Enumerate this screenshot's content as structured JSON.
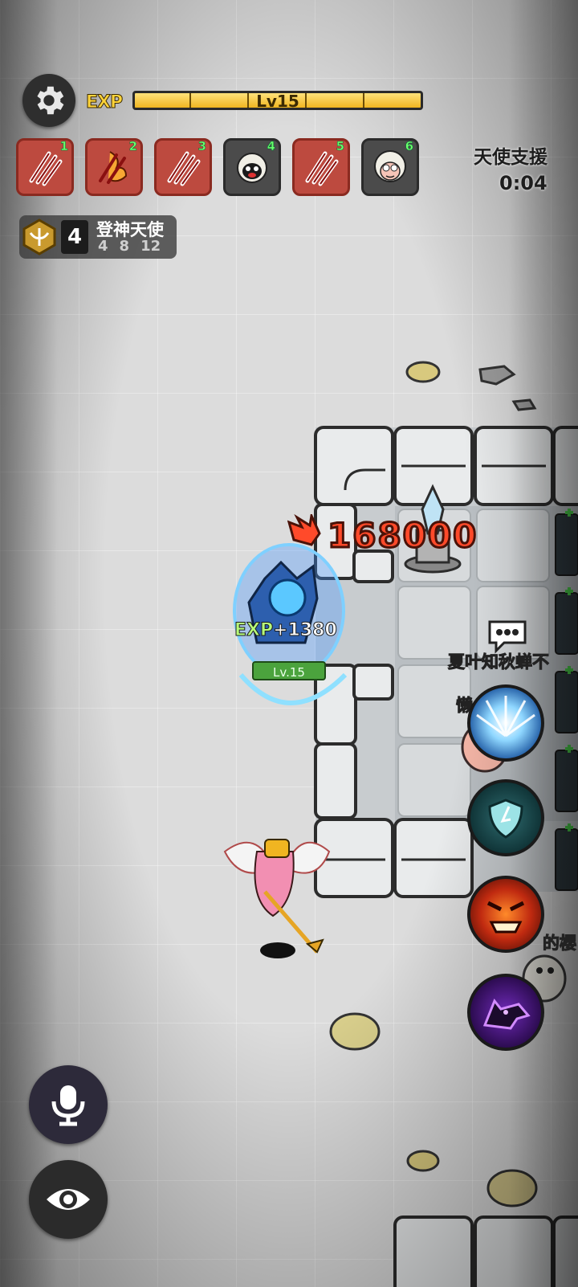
{
  "hud": {
    "exp_label": "EXP",
    "level_text": "Lv15",
    "exp_progress": 1.0
  },
  "skill_slots": [
    {
      "num": "1",
      "style": "red",
      "icon": "claw-icon"
    },
    {
      "num": "2",
      "style": "red",
      "icon": "flame-claw-icon"
    },
    {
      "num": "3",
      "style": "red",
      "icon": "claw-icon"
    },
    {
      "num": "4",
      "style": "dark",
      "icon": "black-sheep-icon"
    },
    {
      "num": "5",
      "style": "red",
      "icon": "claw-icon"
    },
    {
      "num": "6",
      "style": "dark",
      "icon": "white-sheep-icon"
    }
  ],
  "support": {
    "label": "天使支援",
    "timer": "0:04"
  },
  "title_badge": {
    "count": "4",
    "name": "登神天使",
    "tiers": [
      "4",
      "8",
      "12"
    ]
  },
  "combat": {
    "damage": "168000",
    "exp_tag": "EXP",
    "exp_gain": "+1380",
    "enemy_level": "Lv.15"
  },
  "other_players": {
    "name_1": "夏叶知秋蝉不",
    "name_2": "懒",
    "name_3": "的樱"
  },
  "colors": {
    "exp_fill": "#f0b521",
    "damage_text": "#ff4a2a",
    "slot_red": "#bd4a3f",
    "level_badge": "#4ba33d"
  }
}
